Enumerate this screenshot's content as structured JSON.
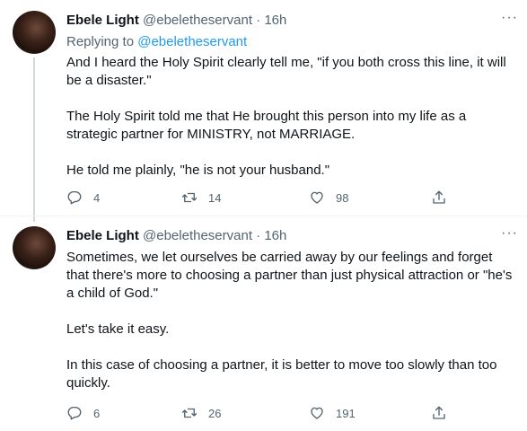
{
  "tweets": [
    {
      "author_name": "Ebele Light",
      "author_handle": "@ebeletheservant",
      "separator": "·",
      "time": "16h",
      "more": "···",
      "replying_prefix": "Replying to",
      "replying_to": "@ebeletheservant",
      "paragraphs": [
        "And I heard the Holy Spirit clearly tell me, \"if you both cross this line, it will be a disaster.\"",
        "The Holy Spirit told me that He brought this person into my life as a strategic partner for MINISTRY, not MARRIAGE.",
        "He told me plainly, \"he is not your husband.\""
      ],
      "replies": "4",
      "retweets": "14",
      "likes": "98"
    },
    {
      "author_name": "Ebele Light",
      "author_handle": "@ebeletheservant",
      "separator": "·",
      "time": "16h",
      "more": "···",
      "paragraphs": [
        "Sometimes, we let ourselves be carried away by our feelings and forget that there's more to choosing a partner than just physical attraction or \"he's a child of God.\"",
        "Let's take it easy.",
        "In this case of choosing a partner, it is better to move too slowly than too quickly."
      ],
      "replies": "6",
      "retweets": "26",
      "likes": "191"
    }
  ],
  "icons": {
    "reply": "reply-icon",
    "retweet": "retweet-icon",
    "like": "heart-icon",
    "share": "share-icon",
    "more": "more-icon"
  },
  "colors": {
    "text": "#0f1419",
    "muted": "#536471",
    "link": "#1d9bf0",
    "divider": "#eff3f4",
    "thread_line": "#cfd9de"
  }
}
